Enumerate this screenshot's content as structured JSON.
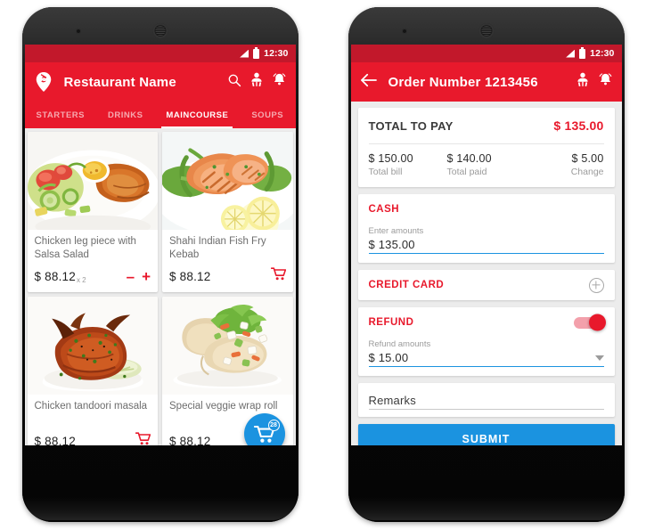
{
  "colors": {
    "brand_red": "#e8192c",
    "status_red": "#c2182b",
    "accent_blue": "#1b93e0",
    "screen_bg": "#ececec",
    "card_white": "#ffffff"
  },
  "status_bar": {
    "time": "12:30",
    "signal_icon": "signal-triangle-icon",
    "battery_icon": "battery-icon"
  },
  "menu_screen": {
    "appbar": {
      "logo_icon": "location-pin-logo-icon",
      "title": "Restaurant Name",
      "icons": [
        "search-icon",
        "waiter-call-icon",
        "notification-bell-icon"
      ]
    },
    "tabs": [
      {
        "label": "STARTERS",
        "active": false
      },
      {
        "label": "DRINKS",
        "active": false
      },
      {
        "label": "MAINCOURSE",
        "active": true
      },
      {
        "label": "SOUPS",
        "active": false
      }
    ],
    "items": [
      {
        "name": "Chicken leg piece with Salsa Salad",
        "price": "$ 88.12",
        "qty_label": "x 2",
        "control": "stepper",
        "minus_label": "–",
        "plus_label": "+",
        "image": "grilled-chicken-salad"
      },
      {
        "name": "Shahi Indian Fish Fry Kebab",
        "price": "$ 88.12",
        "qty_label": "",
        "control": "cart",
        "image": "salmon-lemon"
      },
      {
        "name": "Chicken tandoori masala",
        "price": "$ 88.12",
        "qty_label": "",
        "control": "cart",
        "image": "tandoori-chicken"
      },
      {
        "name": "Special veggie wrap roll",
        "price": "$ 88.12",
        "qty_label": "",
        "control": "none",
        "image": "veggie-wrap"
      }
    ],
    "fab": {
      "icon": "shopping-cart-icon",
      "badge": "28"
    }
  },
  "payment_screen": {
    "appbar": {
      "back_icon": "back-arrow-icon",
      "title": "Order Number 1213456",
      "icons": [
        "waiter-call-icon",
        "notification-bell-icon"
      ]
    },
    "total": {
      "label": "TOTAL TO PAY",
      "value": "$ 135.00"
    },
    "summary": [
      {
        "amount": "$ 150.00",
        "caption": "Total bill"
      },
      {
        "amount": "$ 140.00",
        "caption": "Total paid"
      },
      {
        "amount": "$ 5.00",
        "caption": "Change"
      }
    ],
    "cash": {
      "title": "CASH",
      "field_label": "Enter amounts",
      "field_value": "$ 135.00"
    },
    "credit_card": {
      "title": "CREDIT CARD",
      "add_icon": "plus-circle-icon"
    },
    "refund": {
      "title": "REFUND",
      "toggle_on": true,
      "field_label": "Refund amounts",
      "field_value": "$ 15.00",
      "dropdown_icon": "caret-down-icon"
    },
    "remarks": {
      "placeholder": "Remarks"
    },
    "submit": {
      "label": "SUBMIT"
    }
  }
}
